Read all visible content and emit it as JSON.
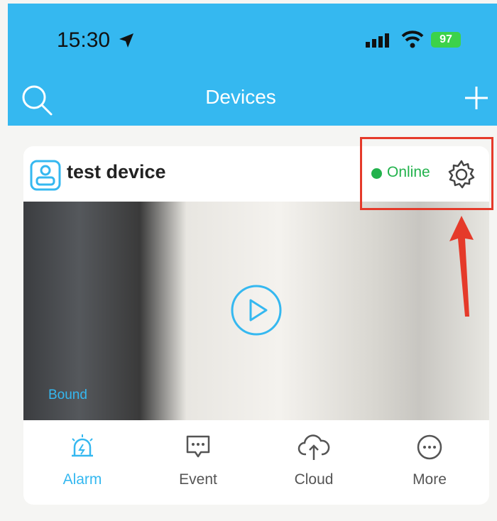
{
  "status_bar": {
    "time": "15:30",
    "battery": "97",
    "icons": [
      "location-arrow-icon",
      "signal-icon",
      "wifi-icon",
      "battery-icon"
    ]
  },
  "header": {
    "title": "Devices",
    "left_icon": "search-icon",
    "right_icon": "add-icon",
    "background_color": "#35b8f0"
  },
  "device_card": {
    "name": "test device",
    "status": "Online",
    "status_color": "#22b24c",
    "preview_label": "Bound",
    "actions": [
      {
        "label": "Alarm",
        "icon": "alarm-icon",
        "active": true
      },
      {
        "label": "Event",
        "icon": "event-icon",
        "active": false
      },
      {
        "label": "Cloud",
        "icon": "cloud-upload-icon",
        "active": false
      },
      {
        "label": "More",
        "icon": "more-icon",
        "active": false
      }
    ]
  },
  "annotation": {
    "color": "#e53a2a"
  }
}
